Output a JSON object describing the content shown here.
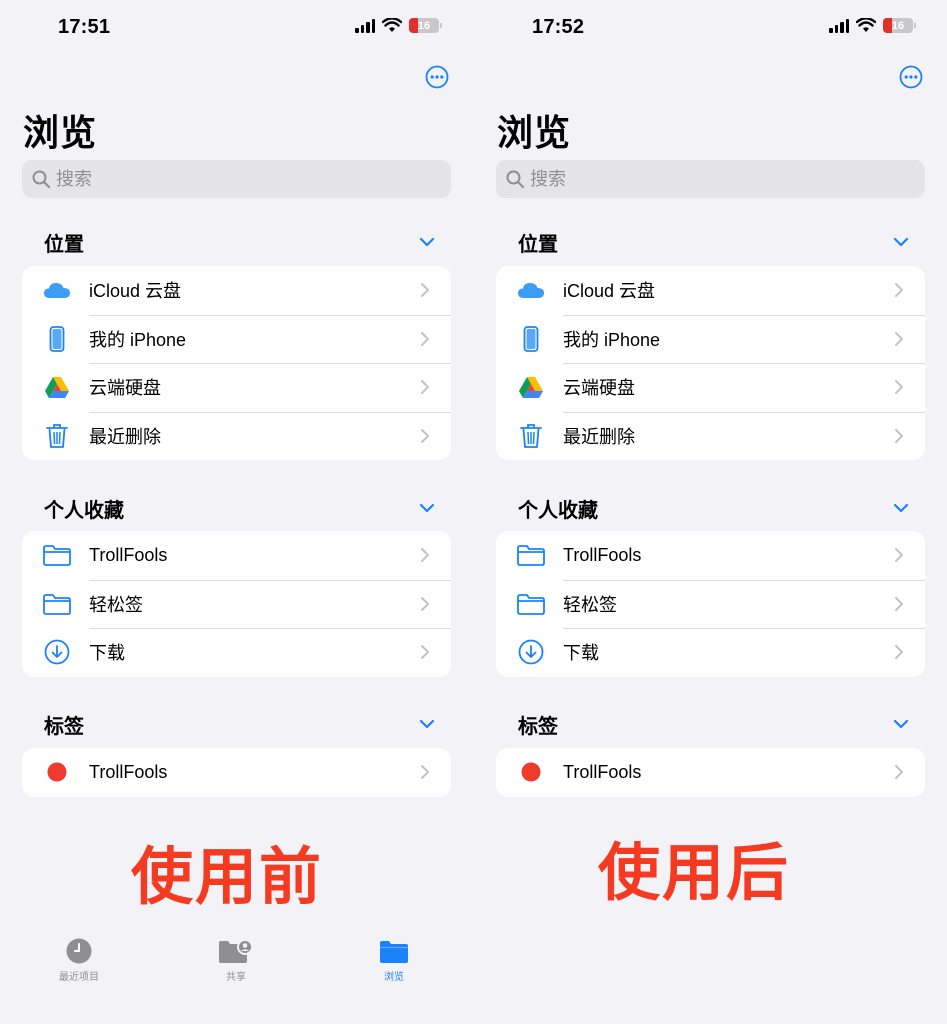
{
  "colors": {
    "accent": "#1a82fb",
    "caption": "#f53a22",
    "tag_red": "#f03a2e"
  },
  "panels": [
    {
      "time": "17:51",
      "battery": "16",
      "title": "浏览",
      "search_placeholder": "搜索",
      "sections": [
        {
          "title": "位置",
          "items": [
            {
              "label": "iCloud 云盘",
              "icon": "icloud-icon"
            },
            {
              "label": "我的 iPhone",
              "icon": "iphone-icon"
            },
            {
              "label": "云端硬盘",
              "icon": "google-drive-icon"
            },
            {
              "label": "最近删除",
              "icon": "trash-icon"
            }
          ]
        },
        {
          "title": "个人收藏",
          "items": [
            {
              "label": "TrollFools",
              "icon": "folder-icon"
            },
            {
              "label": "轻松签",
              "icon": "folder-icon"
            },
            {
              "label": "下载",
              "icon": "download-icon"
            }
          ]
        },
        {
          "title": "标签",
          "items": [
            {
              "label": "TrollFools",
              "icon": "red-tag-dot-icon"
            }
          ]
        }
      ],
      "caption": "使用前",
      "tabs": [
        {
          "label": "最近项目",
          "icon": "clock-icon"
        },
        {
          "label": "共享",
          "icon": "shared-folder-icon"
        },
        {
          "label": "浏览",
          "icon": "folder-icon",
          "active": true
        }
      ]
    },
    {
      "time": "17:52",
      "battery": "16",
      "title": "浏览",
      "search_placeholder": "搜索",
      "sections": [
        {
          "title": "位置",
          "items": [
            {
              "label": "iCloud 云盘",
              "icon": "icloud-icon"
            },
            {
              "label": "我的 iPhone",
              "icon": "iphone-icon"
            },
            {
              "label": "云端硬盘",
              "icon": "google-drive-icon"
            },
            {
              "label": "最近删除",
              "icon": "trash-icon"
            }
          ]
        },
        {
          "title": "个人收藏",
          "items": [
            {
              "label": "TrollFools",
              "icon": "folder-icon"
            },
            {
              "label": "轻松签",
              "icon": "folder-icon"
            },
            {
              "label": "下载",
              "icon": "download-icon"
            }
          ]
        },
        {
          "title": "标签",
          "items": [
            {
              "label": "TrollFools",
              "icon": "red-tag-dot-icon"
            }
          ]
        }
      ],
      "caption": "使用后"
    }
  ]
}
